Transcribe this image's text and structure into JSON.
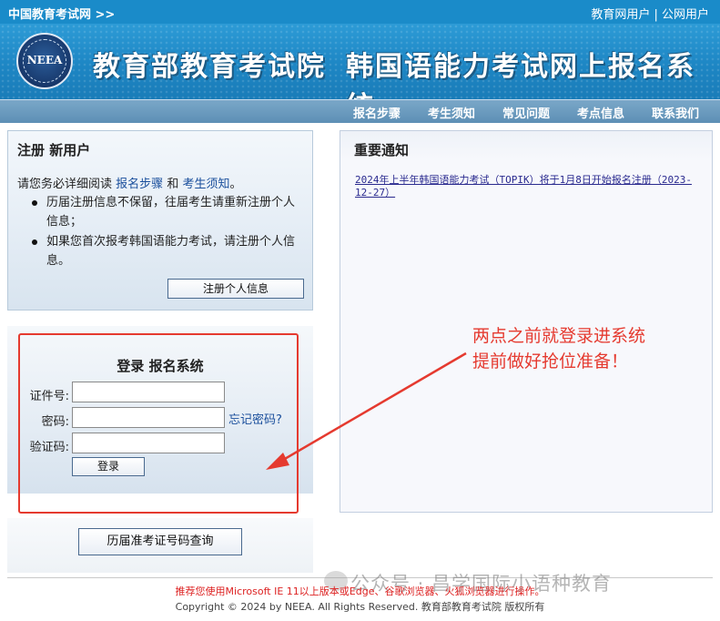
{
  "topbar": {
    "site_link": "中国教育考试网 >>",
    "user_links": "教育网用户 | 公网用户"
  },
  "banner": {
    "logo_text": "NEEA",
    "org_title": "教育部教育考试院",
    "system_title": "韩国语能力考试网上报名系统"
  },
  "nav": {
    "items": [
      "报名步骤",
      "考生须知",
      "常见问题",
      "考点信息",
      "联系我们"
    ]
  },
  "register": {
    "title": "注册 新用户",
    "intro_prefix": "请您务必详细阅读",
    "link_steps": "报名步骤",
    "and": "和",
    "link_notice": "考生须知",
    "period": "。",
    "bullets": [
      "历届注册信息不保留，往届考生请重新注册个人信息；",
      "如果您首次报考韩国语能力考试，请注册个人信息。"
    ],
    "button": "注册个人信息"
  },
  "login": {
    "title": "登录 报名系统",
    "id_label": "证件号:",
    "password_label": "密码:",
    "captcha_label": "验证码:",
    "forgot": "忘记密码?",
    "button": "登录"
  },
  "history": {
    "button": "历届准考证号码查询"
  },
  "notice": {
    "title": "重要通知",
    "item": "2024年上半年韩国语能力考试（TOPIK）将于1月8日开始报名注册（2023-12-27）"
  },
  "annotation": {
    "line1": "两点之前就登录进系统",
    "line2": "提前做好抢位准备！"
  },
  "footer": {
    "recommend": "推荐您使用Microsoft IE 11以上版本或Edge、谷歌浏览器、火狐浏览器进行操作。",
    "copyright": "Copyright © 2024 by NEEA. All Rights Reserved. 教育部教育考试院 版权所有"
  },
  "watermark": "公众号 · 昌学国际小语种教育",
  "colors": {
    "topbar": "#1a8bc9",
    "nav": "#5d8fb5",
    "annotation_red": "#e53a2f",
    "link_blue": "#1a4f9c"
  }
}
